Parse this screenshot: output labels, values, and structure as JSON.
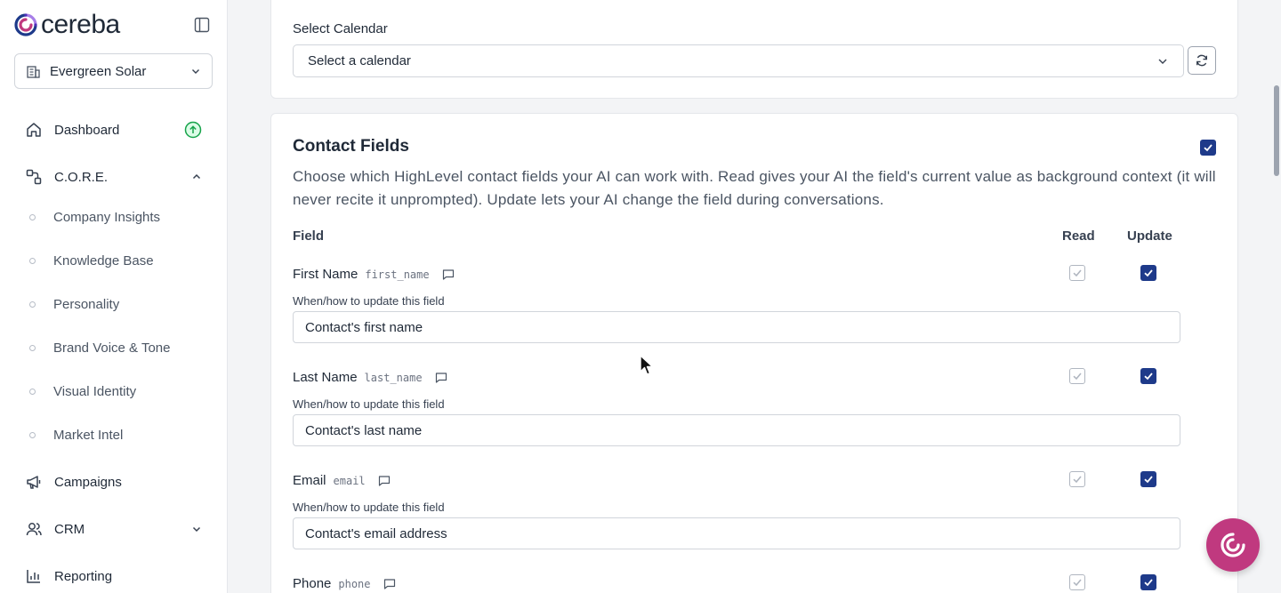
{
  "brand": {
    "name": "cereba"
  },
  "workspace": {
    "name": "Evergreen Solar"
  },
  "nav": {
    "dashboard": "Dashboard",
    "core": "C.O.R.E.",
    "core_items": [
      "Company Insights",
      "Knowledge Base",
      "Personality",
      "Brand Voice & Tone",
      "Visual Identity",
      "Market Intel"
    ],
    "campaigns": "Campaigns",
    "crm": "CRM",
    "reporting": "Reporting"
  },
  "calendar": {
    "label": "Select Calendar",
    "placeholder": "Select a calendar"
  },
  "contact_fields": {
    "title": "Contact Fields",
    "description": "Choose which HighLevel contact fields your AI can work with. Read gives your AI the field's current value as background context (it will never recite it unprompted). Update lets your AI change the field during conversations.",
    "col_field": "Field",
    "col_read": "Read",
    "col_update": "Update",
    "sub_label": "When/how to update this field",
    "fields": [
      {
        "name": "First Name",
        "key": "first_name",
        "value": "Contact's first name"
      },
      {
        "name": "Last Name",
        "key": "last_name",
        "value": "Contact's last name"
      },
      {
        "name": "Email",
        "key": "email",
        "value": "Contact's email address"
      },
      {
        "name": "Phone",
        "key": "phone"
      }
    ]
  },
  "colors": {
    "accent": "#1e3a8a",
    "brand": "#c0397f",
    "success": "#16a34a"
  }
}
